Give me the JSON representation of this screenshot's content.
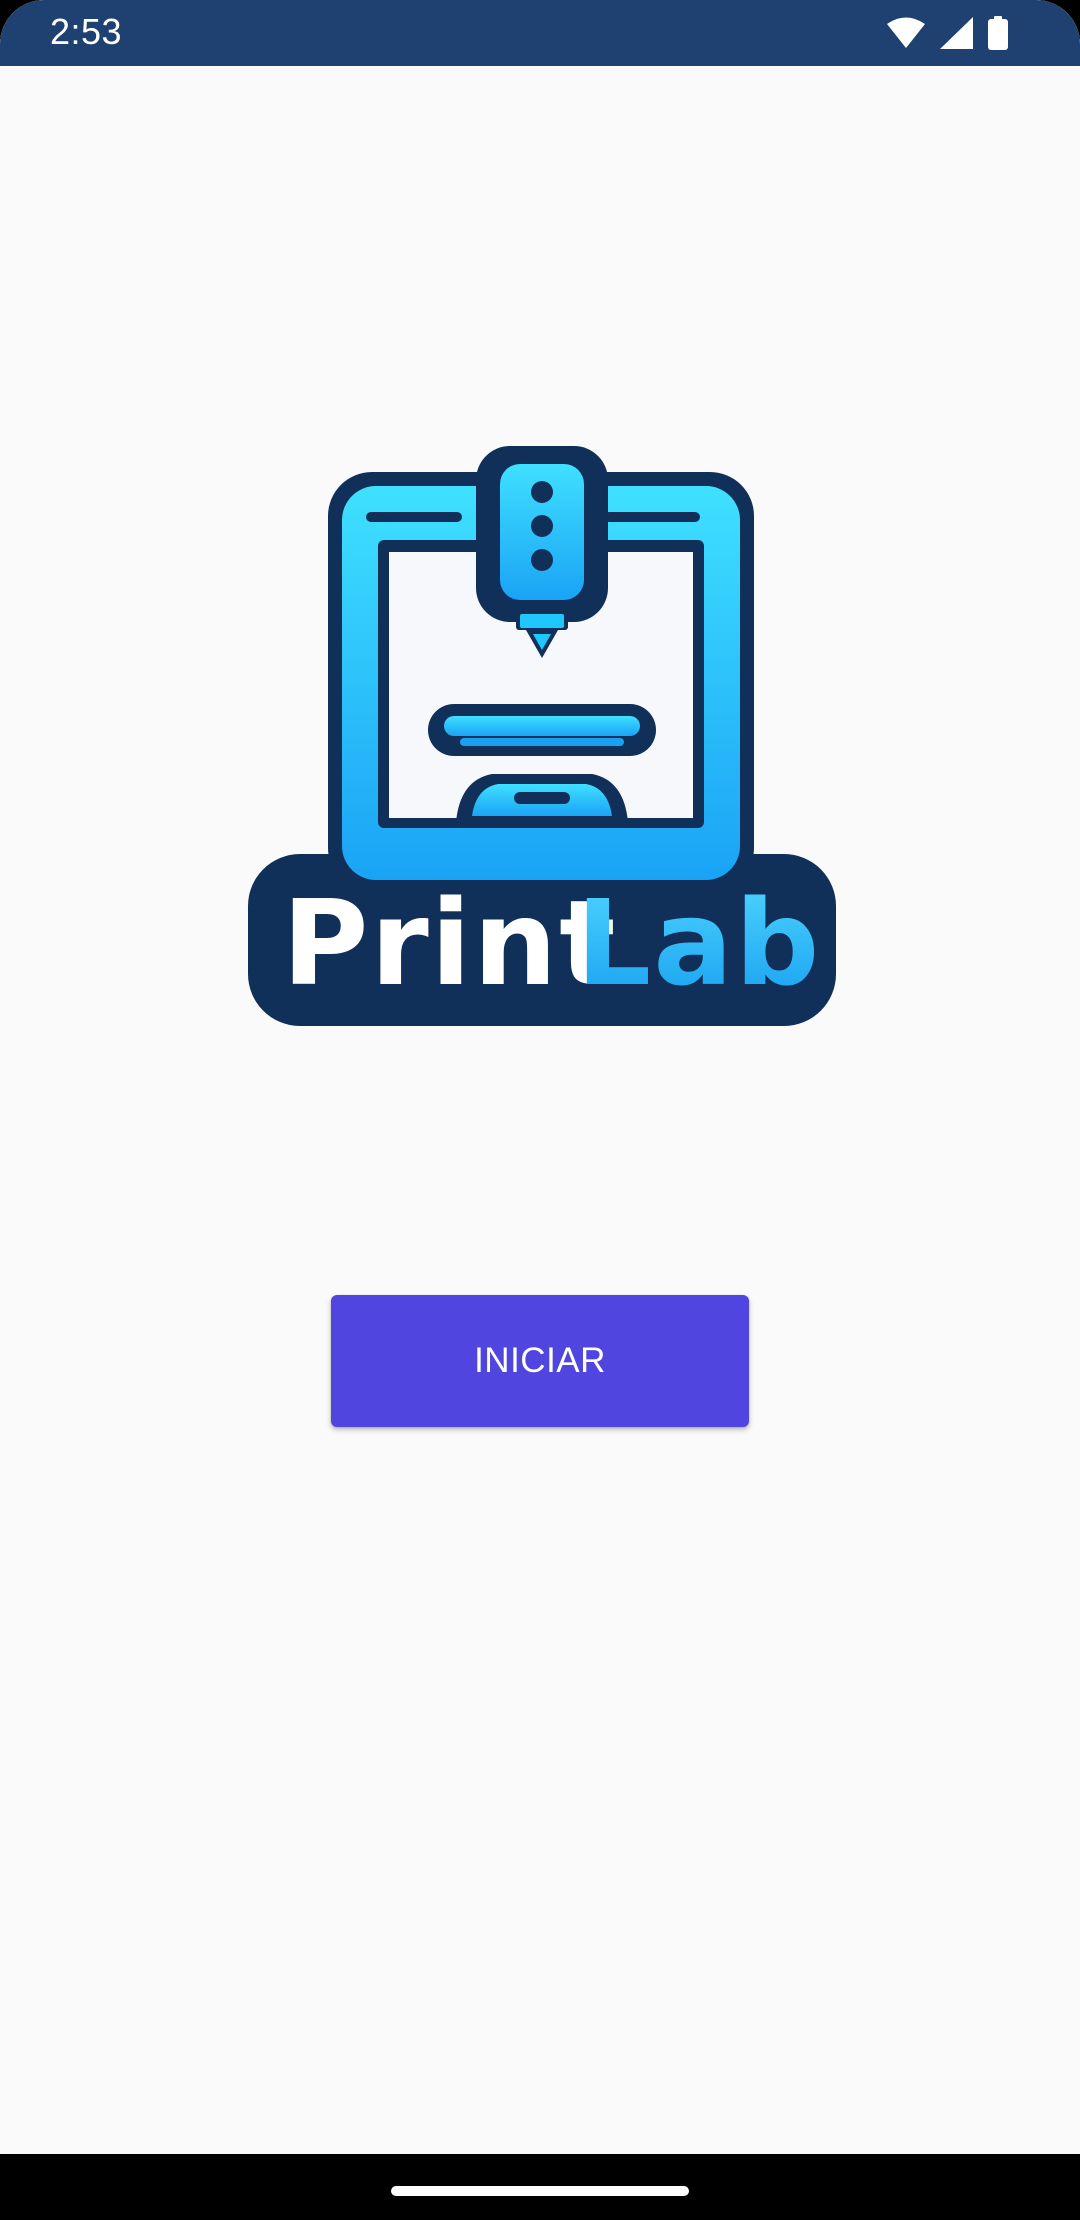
{
  "status_bar": {
    "time": "2:53",
    "background": "#1e4171",
    "icons": [
      "wifi-icon",
      "cell-signal-icon",
      "battery-icon"
    ]
  },
  "logo": {
    "text_part1": "Print",
    "text_part2": "Lab",
    "colors": {
      "navy": "#12325a",
      "cyan": "#1ec8ff",
      "blue": "#1aa0f2",
      "white": "#ffffff"
    }
  },
  "main": {
    "start_button_label": "INICIAR",
    "start_button_color": "#5045df",
    "background": "#fafafa"
  },
  "nav_bar": {
    "background": "#000000",
    "home_indicator": "home-pill"
  }
}
